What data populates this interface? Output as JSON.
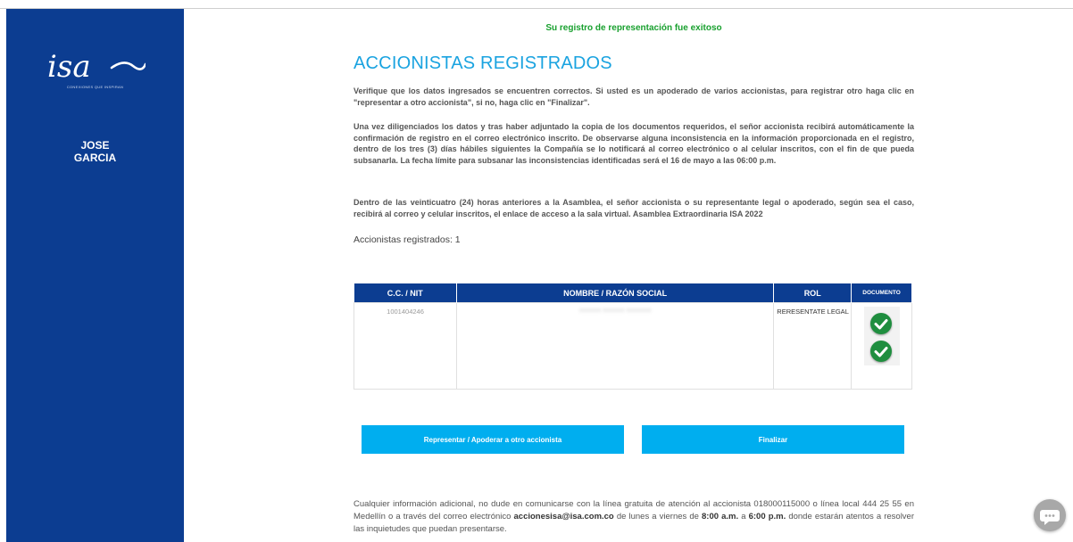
{
  "sidebar": {
    "logo_text": "isa",
    "logo_tagline": "CONEXIONES QUE INSPIRAN",
    "user_first": "JOSE",
    "user_last": "GARCIA"
  },
  "success_message": "Su registro de representación fue exitoso",
  "title": "ACCIONISTAS REGISTRADOS",
  "paragraphs": {
    "p1": "Verifique que los datos ingresados se encuentren correctos. Si usted es un apoderado de varios accionistas, para registrar otro haga clic en \"representar a otro accionista\", si no, haga clic en \"Finalizar\".",
    "p2": "Una vez diligenciados los datos y tras haber adjuntado la copia de los documentos requeridos, el señor accionista recibirá automáticamente la confirmación de registro en el correo electrónico inscrito. De observarse alguna inconsistencia en la información proporcionada en el registro, dentro de los tres (3) días hábiles siguientes la Compañía se lo notificará al correo electrónico o al celular inscritos, con el fin de que pueda subsanarla. La fecha límite para subsanar las inconsistencias identificadas será el 16 de mayo a las 06:00 p.m.",
    "p3": "Dentro de las veinticuatro (24) horas anteriores a la Asamblea, el señor accionista o su representante legal o apoderado, según sea el caso, recibirá al correo y celular inscritos, el enlace de acceso a la sala virtual. Asamblea Extraordinaria ISA 2022"
  },
  "registered_count": "Accionistas registrados: 1",
  "table": {
    "headers": [
      "C.C. / NIT",
      "NOMBRE / RAZÓN SOCIAL",
      "ROL",
      "DOCUMENTO"
    ],
    "rows": [
      {
        "id": "1001404246",
        "name": "xxxxxxx xxxxxxx xxxxxxxx",
        "rol": "RERESENTATE LEGAL",
        "documents": [
          "check-icon",
          "check-icon"
        ]
      }
    ]
  },
  "buttons": {
    "represent": "Representar / Apoderar a otro accionista",
    "finish": "Finalizar"
  },
  "footer": {
    "t1": "Cualquier información adicional, no dude en comunicarse con la línea gratuita de atención al accionista 018000115000 o línea local 444 25 55 en Medellín o a través del correo electrónico ",
    "email": "accionesisa@isa.com.co",
    "t2": " de lunes a viernes de ",
    "time_start": "8:00 a.m.",
    "t3": " a ",
    "time_end": "6:00 p.m.",
    "t4": " donde estarán atentos a resolver las inquietudes que puedan presentarse."
  },
  "colors": {
    "sidebar": "#0c3d91",
    "accent": "#00aeef",
    "title": "#1aa3e0",
    "success": "#18a02e"
  }
}
